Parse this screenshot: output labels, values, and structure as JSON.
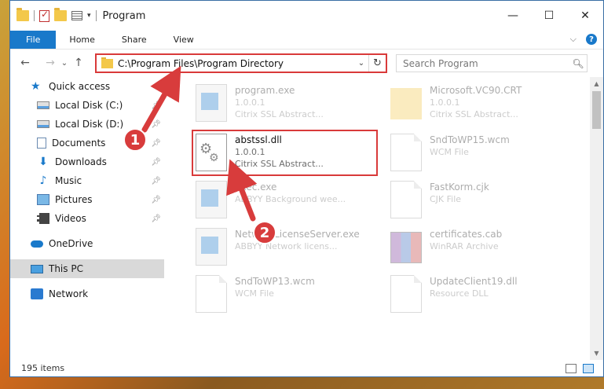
{
  "titlebar": {
    "title": "Program",
    "minimize": "—",
    "maximize": "☐",
    "close": "✕"
  },
  "ribbon": {
    "tabs": [
      "File",
      "Home",
      "Share",
      "View"
    ],
    "expand": "⌵",
    "help": "?"
  },
  "nav": {
    "back": "←",
    "forward": "→",
    "recent": "⌄",
    "up": "↑"
  },
  "address": {
    "path": "C:\\Program Files\\Program Directory",
    "drop": "⌄",
    "refresh": "↻"
  },
  "search": {
    "placeholder": "Search Program",
    "icon": "search-icon"
  },
  "sidebar": {
    "quick_access": "Quick access",
    "items": [
      {
        "label": "Local Disk (C:)",
        "icon": "drive-icon",
        "pinned": true
      },
      {
        "label": "Local Disk (D:)",
        "icon": "drive-icon",
        "pinned": true
      },
      {
        "label": "Documents",
        "icon": "documents-icon",
        "pinned": true
      },
      {
        "label": "Downloads",
        "icon": "downloads-icon",
        "pinned": true
      },
      {
        "label": "Music",
        "icon": "music-icon",
        "pinned": true
      },
      {
        "label": "Pictures",
        "icon": "pictures-icon",
        "pinned": true
      },
      {
        "label": "Videos",
        "icon": "videos-icon",
        "pinned": true
      }
    ],
    "onedrive": "OneDrive",
    "this_pc": "This PC",
    "network": "Network",
    "pin": "📌"
  },
  "files": [
    {
      "name": "program.exe",
      "line1": "1.0.0.1",
      "line2": "Citrix SSL Abstract...",
      "icon": "exe-icon",
      "faded": true
    },
    {
      "name": "Microsoft.VC90.CRT",
      "line1": "1.0.0.1",
      "line2": "Citrix SSL Abstract...",
      "icon": "folder-icon",
      "faded": true
    },
    {
      "name": "abstssl.dll",
      "line1": "1.0.0.1",
      "line2": "Citrix SSL Abstract...",
      "icon": "dll-icon",
      "faded": false
    },
    {
      "name": "SndToWP15.wcm",
      "line1": "WCM File",
      "line2": "",
      "icon": "file-icon",
      "faded": true
    },
    {
      "name": "Exec.exe",
      "line1": "ABBYY Background wee...",
      "line2": "",
      "icon": "exe-icon",
      "faded": true
    },
    {
      "name": "FastKorm.cjk",
      "line1": "CJK File",
      "line2": "",
      "icon": "file-icon",
      "faded": true
    },
    {
      "name": "NetworkLicenseServer.exe",
      "line1": "ABBYY Network licens...",
      "line2": "",
      "icon": "exe-icon",
      "faded": true
    },
    {
      "name": "certificates.cab",
      "line1": "WinRAR Archive",
      "line2": "",
      "icon": "archive-icon",
      "faded": true
    },
    {
      "name": "SndToWP13.wcm",
      "line1": "WCM File",
      "line2": "",
      "icon": "file-icon",
      "faded": true
    },
    {
      "name": "UpdateClient19.dll",
      "line1": "Resource DLL",
      "line2": "",
      "icon": "file-icon",
      "faded": true
    }
  ],
  "status": {
    "count": "195 items"
  },
  "annotations": {
    "step1": "1",
    "step2": "2",
    "color": "#d83c3c"
  }
}
